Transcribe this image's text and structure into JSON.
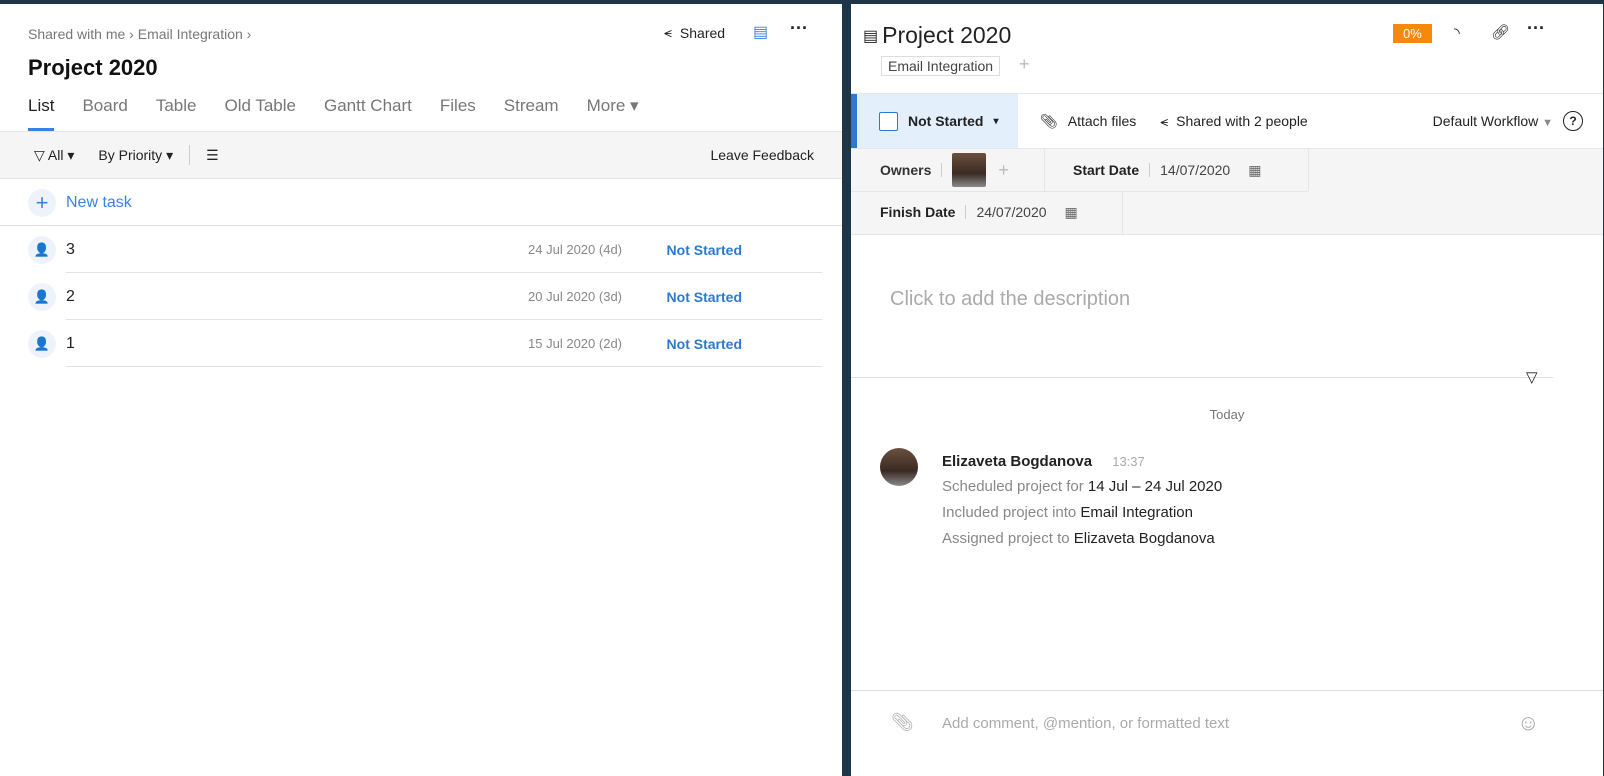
{
  "left": {
    "breadcrumb": [
      "Shared with me",
      "Email Integration"
    ],
    "title": "Project 2020",
    "shared_label": "Shared",
    "tabs": [
      "List",
      "Board",
      "Table",
      "Old Table",
      "Gantt Chart",
      "Files",
      "Stream",
      "More"
    ],
    "toolbar": {
      "filter": "All",
      "group": "By Priority",
      "feedback": "Leave Feedback"
    },
    "new_task": "New task",
    "tasks": [
      {
        "name": "3",
        "date": "24 Jul 2020 (4d)",
        "status": "Not Started"
      },
      {
        "name": "2",
        "date": "20 Jul 2020 (3d)",
        "status": "Not Started"
      },
      {
        "name": "1",
        "date": "15 Jul 2020 (2d)",
        "status": "Not Started"
      }
    ]
  },
  "right": {
    "title": "Project 2020",
    "progress": "0%",
    "folder_tag": "Email Integration",
    "status": "Not Started",
    "attach": "Attach files",
    "shared": "Shared with 2 people",
    "workflow": "Default Workflow",
    "owners_label": "Owners",
    "start_label": "Start Date",
    "start_value": "14/07/2020",
    "finish_label": "Finish Date",
    "finish_value": "24/07/2020",
    "description_placeholder": "Click to add the description",
    "day": "Today",
    "activity": {
      "user": "Elizaveta Bogdanova",
      "time": "13:37",
      "lines": [
        {
          "text": "Scheduled project for ",
          "value": "14 Jul – 24 Jul 2020"
        },
        {
          "text": "Included project into ",
          "value": "Email Integration"
        },
        {
          "text": "Assigned project to ",
          "value": "Elizaveta Bogdanova"
        }
      ]
    },
    "comment_placeholder": "Add comment, @mention, or formatted text"
  },
  "colors": {
    "accent": "#3b82e0",
    "badge": "#f5890a",
    "frame": "#1f3549"
  }
}
